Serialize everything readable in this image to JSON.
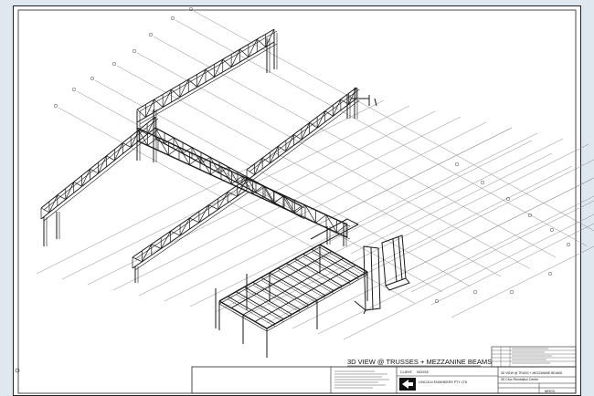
{
  "drawing": {
    "view_title": "3D VIEW @ TRUSSES + MEZZANINE BEAMS",
    "client_label": "CLIENT:",
    "client_value": "NOOSE",
    "company_name": "LINCOLN ENGINEERS PTY LTD",
    "project_name": "3D Civic Recreation Centre",
    "sheet_title_small": "3D VIEW @ TRUSS + MEZZANINE BEAMS",
    "drawing_number": "MR03"
  },
  "colors": {
    "background": "#dfe7ef",
    "sheet": "#ffffff",
    "linework": "#1a1a1a",
    "grid": "#8a8a8a"
  },
  "icons": [
    "north-arrow-icon",
    "company-logo-icon"
  ]
}
